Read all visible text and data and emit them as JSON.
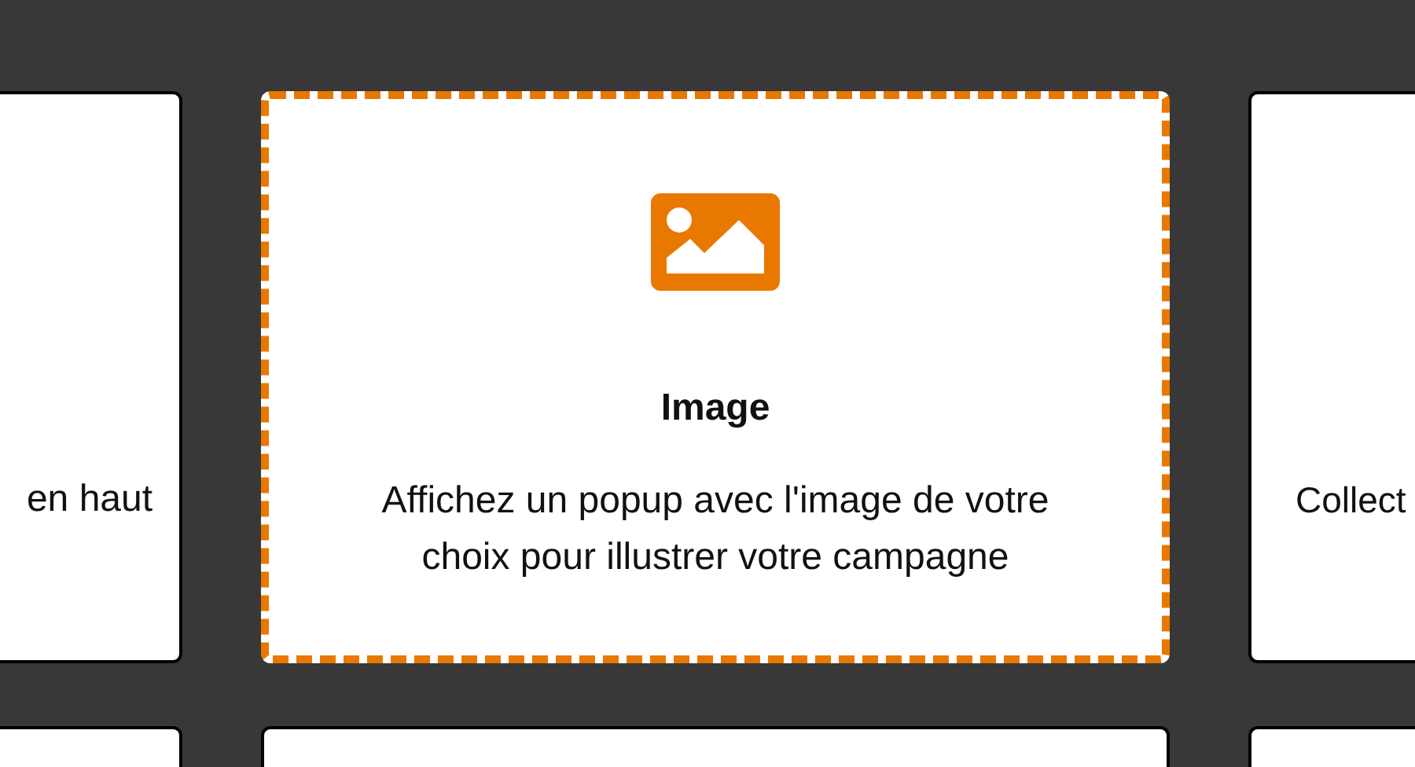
{
  "cards": [
    {
      "description": "en haut",
      "selected": false
    },
    {
      "title": "Image",
      "description": "Affichez un popup avec l'image de votre choix pour illustrer votre campagne",
      "selected": true
    },
    {
      "description": "Collect",
      "selected": false
    }
  ],
  "next_row": [
    {
      "selected": false
    },
    {
      "selected": false
    },
    {
      "selected": false
    }
  ]
}
